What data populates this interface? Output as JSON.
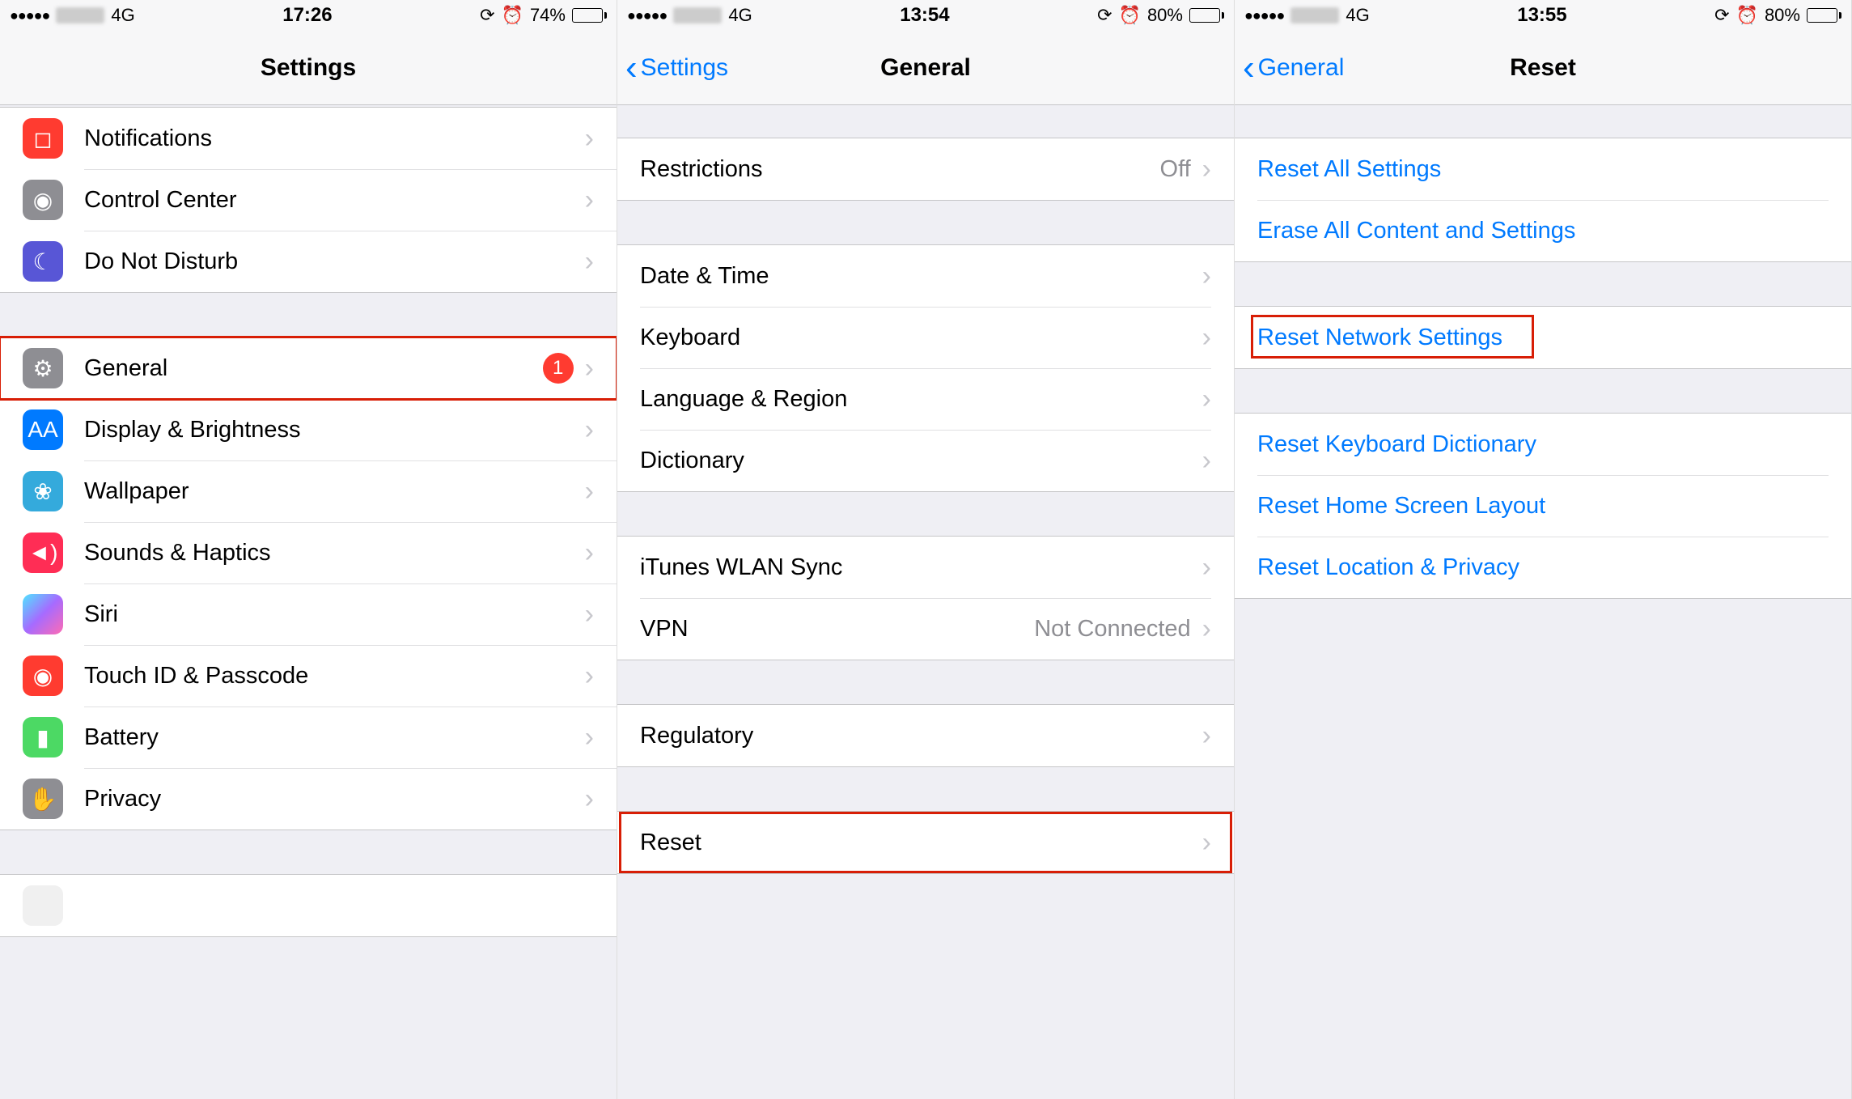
{
  "screen1": {
    "status": {
      "network": "4G",
      "time": "17:26",
      "battery": "74%"
    },
    "nav": {
      "title": "Settings"
    },
    "group1": [
      {
        "key": "notifications",
        "label": "Notifications",
        "iconClass": "ic-red",
        "glyph": "◻"
      },
      {
        "key": "control-center",
        "label": "Control Center",
        "iconClass": "ic-gray",
        "glyph": "◉"
      },
      {
        "key": "do-not-disturb",
        "label": "Do Not Disturb",
        "iconClass": "ic-purple",
        "glyph": "☾"
      }
    ],
    "group2": [
      {
        "key": "general",
        "label": "General",
        "iconClass": "ic-gray",
        "glyph": "⚙",
        "badge": "1",
        "highlight": true
      },
      {
        "key": "display-brightness",
        "label": "Display & Brightness",
        "iconClass": "ic-blue",
        "glyph": "AA"
      },
      {
        "key": "wallpaper",
        "label": "Wallpaper",
        "iconClass": "ic-cyan",
        "glyph": "❀"
      },
      {
        "key": "sounds-haptics",
        "label": "Sounds & Haptics",
        "iconClass": "ic-pink",
        "glyph": "◄)"
      },
      {
        "key": "siri",
        "label": "Siri",
        "iconClass": "ic-siri",
        "glyph": ""
      },
      {
        "key": "touch-id",
        "label": "Touch ID & Passcode",
        "iconClass": "ic-red",
        "glyph": "◉"
      },
      {
        "key": "battery",
        "label": "Battery",
        "iconClass": "ic-green",
        "glyph": "▮"
      },
      {
        "key": "privacy",
        "label": "Privacy",
        "iconClass": "ic-gray",
        "glyph": "✋"
      }
    ]
  },
  "screen2": {
    "status": {
      "network": "4G",
      "time": "13:54",
      "battery": "80%"
    },
    "nav": {
      "back": "Settings",
      "title": "General"
    },
    "groups": [
      [
        {
          "key": "restrictions",
          "label": "Restrictions",
          "detail": "Off"
        }
      ],
      [
        {
          "key": "date-time",
          "label": "Date & Time"
        },
        {
          "key": "keyboard",
          "label": "Keyboard"
        },
        {
          "key": "language-region",
          "label": "Language & Region"
        },
        {
          "key": "dictionary",
          "label": "Dictionary"
        }
      ],
      [
        {
          "key": "itunes-wlan",
          "label": "iTunes WLAN Sync"
        },
        {
          "key": "vpn",
          "label": "VPN",
          "detail": "Not Connected"
        }
      ],
      [
        {
          "key": "regulatory",
          "label": "Regulatory"
        }
      ],
      [
        {
          "key": "reset",
          "label": "Reset",
          "highlight": true
        }
      ]
    ]
  },
  "screen3": {
    "status": {
      "network": "4G",
      "time": "13:55",
      "battery": "80%"
    },
    "nav": {
      "back": "General",
      "title": "Reset"
    },
    "groups": [
      [
        {
          "key": "reset-all",
          "label": "Reset All Settings"
        },
        {
          "key": "erase-all",
          "label": "Erase All Content and Settings"
        }
      ],
      [
        {
          "key": "reset-network",
          "label": "Reset Network Settings",
          "highlight": true
        }
      ],
      [
        {
          "key": "reset-keyboard",
          "label": "Reset Keyboard Dictionary"
        },
        {
          "key": "reset-home",
          "label": "Reset Home Screen Layout"
        },
        {
          "key": "reset-location",
          "label": "Reset Location & Privacy"
        }
      ]
    ]
  }
}
